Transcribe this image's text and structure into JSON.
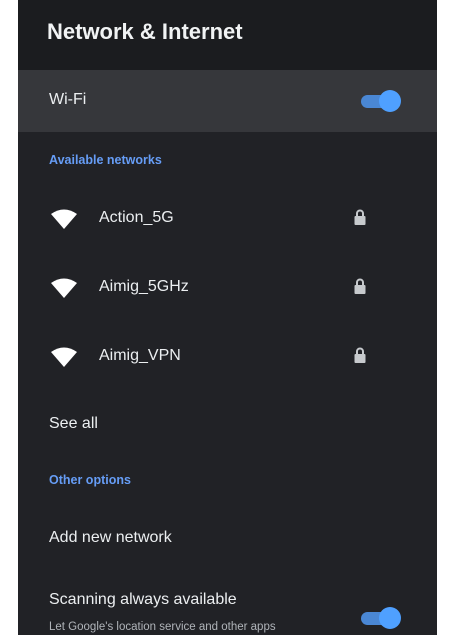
{
  "header": {
    "title": "Network & Internet"
  },
  "wifi": {
    "label": "Wi-Fi",
    "enabled": true
  },
  "available_networks": {
    "section_label": "Available networks",
    "networks": [
      {
        "name": "Action_5G",
        "icon": "wifi-icon",
        "secured": true,
        "lock_icon": "lock-icon"
      },
      {
        "name": "Aimig_5GHz",
        "icon": "wifi-icon",
        "secured": true,
        "lock_icon": "lock-icon"
      },
      {
        "name": "Aimig_VPN",
        "icon": "wifi-icon",
        "secured": true,
        "lock_icon": "lock-icon"
      }
    ],
    "see_all_label": "See all"
  },
  "other_options": {
    "section_label": "Other options",
    "add_network_label": "Add new network",
    "scanning": {
      "title": "Scanning always available",
      "subtitle": "Let Google's location service and other apps",
      "enabled": true
    }
  },
  "colors": {
    "background": "#212226",
    "header_background": "#1b1c1f",
    "focused_row": "#36373b",
    "accent": "#669df6",
    "toggle_thumb": "#4fa0ff",
    "toggle_track": "#4a87d4",
    "text_primary": "#eceff1",
    "text_secondary": "#b0b4b9"
  }
}
